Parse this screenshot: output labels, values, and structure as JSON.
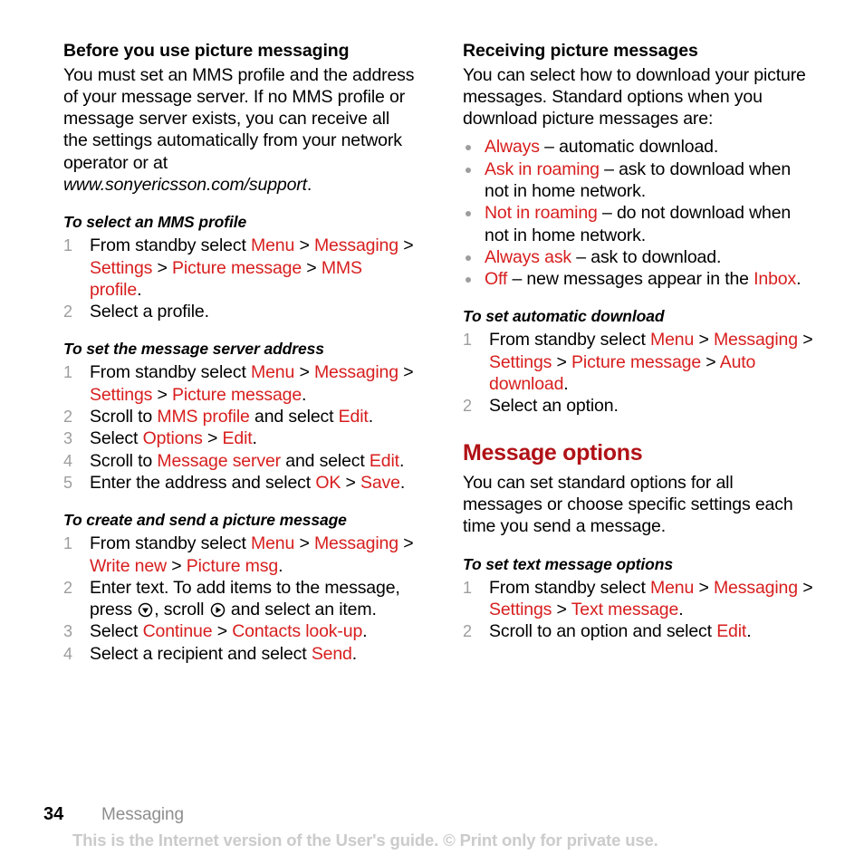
{
  "page": {
    "number": "34",
    "section": "Messaging",
    "watermark": "This is the Internet version of the User's guide. © Print only for private use."
  },
  "colors": {
    "inline_red": "#d81e1e",
    "heading_red": "#b01116",
    "step_number_gray": "#9d9d9d",
    "bullet_gray": "#9d9d9d",
    "footer_gray": "#8e8e8e",
    "watermark_gray": "#cbcbcb",
    "body_black": "#000000"
  },
  "left_column": {
    "heading": "Before you use picture messaging",
    "intro_text_1": "You must set an MMS profile and the address of your message server. If no MMS profile or message server exists, you can receive all the settings automatically from your network operator or at ",
    "intro_url": "www.sonyericsson.com/support",
    "intro_text_2": ".",
    "proc1": {
      "title": "To select an MMS profile",
      "steps": [
        {
          "parts": [
            {
              "t": "From standby select ",
              "k": "plain"
            },
            {
              "t": "Menu",
              "k": "ui"
            },
            {
              "t": " > ",
              "k": "plain"
            },
            {
              "t": "Messaging",
              "k": "ui"
            },
            {
              "t": " > ",
              "k": "plain"
            },
            {
              "t": "Settings",
              "k": "ui"
            },
            {
              "t": " > ",
              "k": "plain"
            },
            {
              "t": "Picture message",
              "k": "ui"
            },
            {
              "t": " > ",
              "k": "plain"
            },
            {
              "t": "MMS profile",
              "k": "ui"
            },
            {
              "t": ".",
              "k": "plain"
            }
          ]
        },
        {
          "parts": [
            {
              "t": "Select a profile.",
              "k": "plain"
            }
          ]
        }
      ]
    },
    "proc2": {
      "title": "To set the message server address",
      "steps": [
        {
          "parts": [
            {
              "t": "From standby select ",
              "k": "plain"
            },
            {
              "t": "Menu",
              "k": "ui"
            },
            {
              "t": " > ",
              "k": "plain"
            },
            {
              "t": "Messaging",
              "k": "ui"
            },
            {
              "t": " > ",
              "k": "plain"
            },
            {
              "t": "Settings",
              "k": "ui"
            },
            {
              "t": " > ",
              "k": "plain"
            },
            {
              "t": "Picture message",
              "k": "ui"
            },
            {
              "t": ".",
              "k": "plain"
            }
          ]
        },
        {
          "parts": [
            {
              "t": "Scroll to ",
              "k": "plain"
            },
            {
              "t": "MMS profile",
              "k": "ui"
            },
            {
              "t": " and select ",
              "k": "plain"
            },
            {
              "t": "Edit",
              "k": "ui"
            },
            {
              "t": ".",
              "k": "plain"
            }
          ]
        },
        {
          "parts": [
            {
              "t": "Select ",
              "k": "plain"
            },
            {
              "t": "Options",
              "k": "ui"
            },
            {
              "t": " > ",
              "k": "plain"
            },
            {
              "t": "Edit",
              "k": "ui"
            },
            {
              "t": ".",
              "k": "plain"
            }
          ]
        },
        {
          "parts": [
            {
              "t": "Scroll to ",
              "k": "plain"
            },
            {
              "t": "Message server",
              "k": "ui"
            },
            {
              "t": " and select ",
              "k": "plain"
            },
            {
              "t": "Edit",
              "k": "ui"
            },
            {
              "t": ".",
              "k": "plain"
            }
          ]
        },
        {
          "parts": [
            {
              "t": "Enter the address and select ",
              "k": "plain"
            },
            {
              "t": "OK",
              "k": "ui"
            },
            {
              "t": " > ",
              "k": "plain"
            },
            {
              "t": "Save",
              "k": "ui"
            },
            {
              "t": ".",
              "k": "plain"
            }
          ]
        }
      ]
    },
    "proc3": {
      "title": "To create and send a picture message",
      "steps": [
        {
          "parts": [
            {
              "t": "From standby select ",
              "k": "plain"
            },
            {
              "t": "Menu",
              "k": "ui"
            },
            {
              "t": " > ",
              "k": "plain"
            },
            {
              "t": "Messaging",
              "k": "ui"
            },
            {
              "t": " > ",
              "k": "plain"
            },
            {
              "t": "Write new",
              "k": "ui"
            },
            {
              "t": " > ",
              "k": "plain"
            },
            {
              "t": "Picture msg",
              "k": "ui"
            },
            {
              "t": ".",
              "k": "plain"
            }
          ]
        },
        {
          "parts": [
            {
              "t": "Enter text. To add items to the message, press ",
              "k": "plain"
            },
            {
              "t": "",
              "k": "icon-navkey-down"
            },
            {
              "t": ", scroll ",
              "k": "plain"
            },
            {
              "t": "",
              "k": "icon-navkey-right"
            },
            {
              "t": " and select an item.",
              "k": "plain"
            }
          ]
        },
        {
          "parts": [
            {
              "t": "Select ",
              "k": "plain"
            },
            {
              "t": "Continue",
              "k": "ui"
            },
            {
              "t": " > ",
              "k": "plain"
            },
            {
              "t": "Contacts look-up",
              "k": "ui"
            },
            {
              "t": ".",
              "k": "plain"
            }
          ]
        },
        {
          "parts": [
            {
              "t": "Select a recipient and select ",
              "k": "plain"
            },
            {
              "t": "Send",
              "k": "ui"
            },
            {
              "t": ".",
              "k": "plain"
            }
          ]
        }
      ]
    }
  },
  "right_column": {
    "heading": "Receiving picture messages",
    "intro_text": "You can select how to download your picture messages. Standard options when you download picture messages are:",
    "bullets": [
      {
        "parts": [
          {
            "t": "Always",
            "k": "ui"
          },
          {
            "t": " – automatic download.",
            "k": "plain"
          }
        ]
      },
      {
        "parts": [
          {
            "t": "Ask in roaming",
            "k": "ui"
          },
          {
            "t": " – ask to download when not in home network.",
            "k": "plain"
          }
        ]
      },
      {
        "parts": [
          {
            "t": "Not in roaming",
            "k": "ui"
          },
          {
            "t": " – do not download when not in home network.",
            "k": "plain"
          }
        ]
      },
      {
        "parts": [
          {
            "t": "Always ask",
            "k": "ui"
          },
          {
            "t": " – ask to download.",
            "k": "plain"
          }
        ]
      },
      {
        "parts": [
          {
            "t": "Off",
            "k": "ui"
          },
          {
            "t": " – new messages appear in the ",
            "k": "plain"
          },
          {
            "t": "Inbox",
            "k": "ui"
          },
          {
            "t": ".",
            "k": "plain"
          }
        ]
      }
    ],
    "proc1": {
      "title": "To set automatic download",
      "steps": [
        {
          "parts": [
            {
              "t": "From standby select ",
              "k": "plain"
            },
            {
              "t": "Menu",
              "k": "ui"
            },
            {
              "t": " > ",
              "k": "plain"
            },
            {
              "t": "Messaging",
              "k": "ui"
            },
            {
              "t": " > ",
              "k": "plain"
            },
            {
              "t": "Settings",
              "k": "ui"
            },
            {
              "t": " > ",
              "k": "plain"
            },
            {
              "t": "Picture message",
              "k": "ui"
            },
            {
              "t": " > ",
              "k": "plain"
            },
            {
              "t": "Auto download",
              "k": "ui"
            },
            {
              "t": ".",
              "k": "plain"
            }
          ]
        },
        {
          "parts": [
            {
              "t": "Select an option.",
              "k": "plain"
            }
          ]
        }
      ]
    },
    "section_heading": "Message options",
    "section_text": "You can set standard options for all messages or choose specific settings each time you send a message.",
    "proc2": {
      "title": "To set text message options",
      "steps": [
        {
          "parts": [
            {
              "t": "From standby select ",
              "k": "plain"
            },
            {
              "t": "Menu",
              "k": "ui"
            },
            {
              "t": " > ",
              "k": "plain"
            },
            {
              "t": "Messaging",
              "k": "ui"
            },
            {
              "t": " > ",
              "k": "plain"
            },
            {
              "t": "Settings",
              "k": "ui"
            },
            {
              "t": " > ",
              "k": "plain"
            },
            {
              "t": "Text message",
              "k": "ui"
            },
            {
              "t": ".",
              "k": "plain"
            }
          ]
        },
        {
          "parts": [
            {
              "t": "Scroll to an option and select ",
              "k": "plain"
            },
            {
              "t": "Edit",
              "k": "ui"
            },
            {
              "t": ".",
              "k": "plain"
            }
          ]
        }
      ]
    }
  }
}
